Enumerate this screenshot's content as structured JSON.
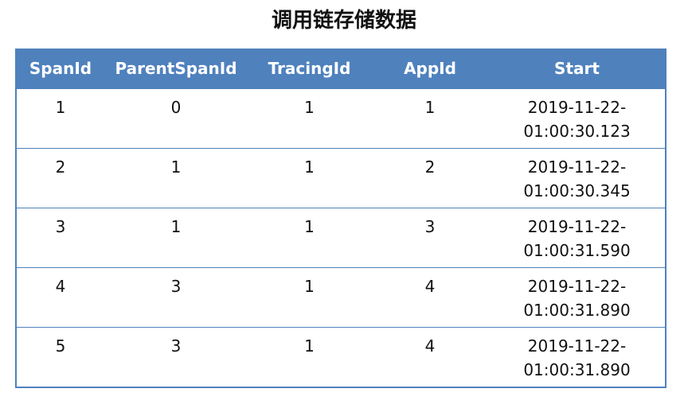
{
  "title": "调用链存储数据",
  "colors": {
    "header_bg": "#4f81bd",
    "header_text": "#ffffff",
    "border": "#4f81bd"
  },
  "table": {
    "headers": [
      "SpanId",
      "ParentSpanId",
      "TracingId",
      "AppId",
      "Start"
    ],
    "rows": [
      {
        "span_id": "1",
        "parent_span_id": "0",
        "tracing_id": "1",
        "app_id": "1",
        "start_date": "2019-11-22-",
        "start_time": "01:00:30.123"
      },
      {
        "span_id": "2",
        "parent_span_id": "1",
        "tracing_id": "1",
        "app_id": "2",
        "start_date": "2019-11-22-",
        "start_time": "01:00:30.345"
      },
      {
        "span_id": "3",
        "parent_span_id": "1",
        "tracing_id": "1",
        "app_id": "3",
        "start_date": "2019-11-22-",
        "start_time": "01:00:31.590"
      },
      {
        "span_id": "4",
        "parent_span_id": "3",
        "tracing_id": "1",
        "app_id": "4",
        "start_date": "2019-11-22-",
        "start_time": "01:00:31.890"
      },
      {
        "span_id": "5",
        "parent_span_id": "3",
        "tracing_id": "1",
        "app_id": "4",
        "start_date": "2019-11-22-",
        "start_time": "01:00:31.890"
      }
    ]
  }
}
